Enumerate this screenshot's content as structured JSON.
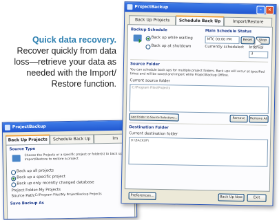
{
  "caption": {
    "headline": "Quick data recovery.",
    "body": "Recover quickly from data loss—retrieve your data as needed with the Import/ Restore function."
  },
  "main_window": {
    "title": "ProjectBackup",
    "tabs": [
      "Back Up Projects",
      "Schedule Back Up",
      "Import/Restore"
    ],
    "backup_schedule_heading": "Backup Schedule",
    "radio_now": "Back up while waiting",
    "radio_shutdown": "Back up at shutdown",
    "main_schedule_heading": "Main Schedule Status",
    "status_value": "MTC 00:00 PM",
    "reset_label": "Reset",
    "stop_label": "Stop",
    "currently_label": "Currently scheduled:",
    "interval_label": "Interval",
    "interval_value": "3",
    "source_heading": "Source Folder",
    "source_desc": "You can schedule back ups for multiple project folders. Back ups will occur at specified times and will be saved and import while ProjectBackup Offline.",
    "current_source_label": "Current source folder",
    "source_list_item": "C:\\Program Files\\Projects",
    "add_source_label": "Add Folder to Source Selections...",
    "remove_label": "Remove",
    "remove_all_label": "Remove All",
    "dest_heading": "Destination Folder",
    "current_dest_label": "Current destination folder",
    "dest_value": "D:\\BACKUP\\",
    "preferences_label": "Preferences...",
    "backup_now_label": "Back Up Now",
    "exit_label": "Exit"
  },
  "back_window": {
    "title": "ProjectBackup",
    "tabs": [
      "Back Up Projects",
      "Schedule Back Up",
      "Im"
    ],
    "source_heading": "Source Type",
    "source_desc": "Choose the Projects or a specific project or folder(s) to back up. Import/Restore to restore a project",
    "option_all": "Back up all projects",
    "option_specific": "Back up a specific project",
    "option_recent": "Back up only recently changed database",
    "project_folder_label": "Project Folder:",
    "project_folder_value": "My Projects",
    "source_path_label": "Source Path:",
    "source_path_value": "C:\\Program Files\\My ProjectBackup Projects",
    "save_heading": "Save Backup As"
  }
}
